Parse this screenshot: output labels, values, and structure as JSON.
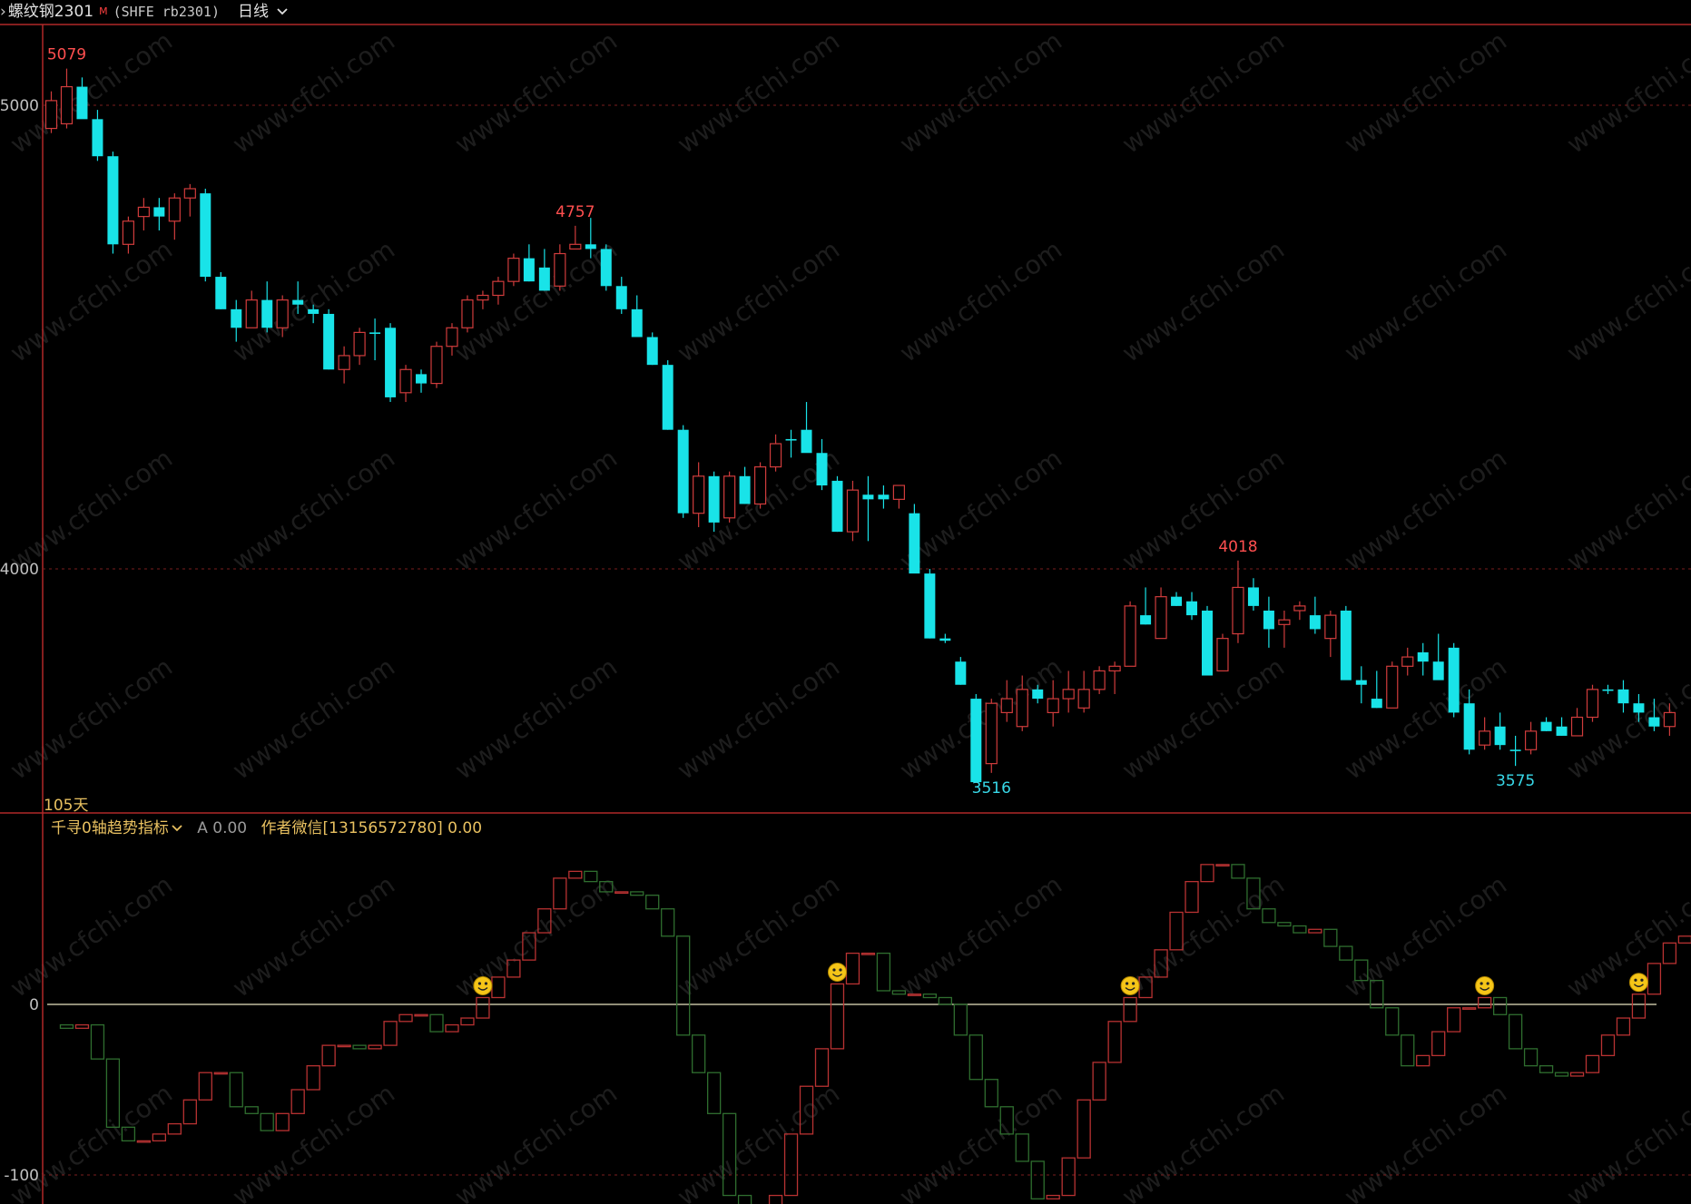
{
  "header": {
    "symbol": "螺纹钢2301",
    "marker": "M",
    "code": "(SHFE rb2301)",
    "period": "日线",
    "dropdown_icon": "chevron-down-icon"
  },
  "watermark_text": "www.cfchi.com",
  "days_label": "105天",
  "indicator": {
    "name": "千寻0轴趋势指标",
    "a_label": "A 0.00",
    "author_label": "作者微信[13156572780] 0.00",
    "signal_icon": "smiley-icon"
  },
  "colors": {
    "background": "#000000",
    "bear": "#19e3e8",
    "bull": "#d03c3c",
    "ind_up": "#b83232",
    "ind_down": "#2f6e2f",
    "zero_line": "#e8e4c0",
    "high_label": "#ff4f4f",
    "low_label": "#38d8e8"
  },
  "chart_data": [
    {
      "type": "candlestick",
      "yticks": [
        "5000",
        "4000"
      ],
      "ylim": [
        3470,
        5170
      ],
      "annotations": [
        {
          "index": 1,
          "text": "5079",
          "kind": "high"
        },
        {
          "index": 34,
          "text": "4757",
          "kind": "high"
        },
        {
          "index": 61,
          "text": "3516",
          "kind": "low"
        },
        {
          "index": 77,
          "text": "4018",
          "kind": "high"
        },
        {
          "index": 95,
          "text": "3575",
          "kind": "low"
        }
      ],
      "ohlc": [
        [
          4950,
          5030,
          4940,
          5010
        ],
        [
          4960,
          5079,
          4950,
          5040
        ],
        [
          5040,
          5060,
          4980,
          4970
        ],
        [
          4970,
          4990,
          4880,
          4890
        ],
        [
          4890,
          4900,
          4680,
          4700
        ],
        [
          4700,
          4760,
          4680,
          4750
        ],
        [
          4760,
          4800,
          4730,
          4780
        ],
        [
          4780,
          4800,
          4730,
          4760
        ],
        [
          4750,
          4810,
          4710,
          4800
        ],
        [
          4800,
          4830,
          4760,
          4820
        ],
        [
          4810,
          4820,
          4620,
          4630
        ],
        [
          4630,
          4640,
          4560,
          4560
        ],
        [
          4560,
          4580,
          4490,
          4520
        ],
        [
          4520,
          4600,
          4520,
          4580
        ],
        [
          4580,
          4620,
          4510,
          4520
        ],
        [
          4520,
          4590,
          4500,
          4580
        ],
        [
          4580,
          4620,
          4550,
          4570
        ],
        [
          4560,
          4570,
          4530,
          4550
        ],
        [
          4550,
          4560,
          4430,
          4430
        ],
        [
          4430,
          4480,
          4400,
          4460
        ],
        [
          4460,
          4520,
          4440,
          4510
        ],
        [
          4510,
          4540,
          4450,
          4510
        ],
        [
          4520,
          4530,
          4360,
          4370
        ],
        [
          4380,
          4440,
          4360,
          4430
        ],
        [
          4420,
          4430,
          4380,
          4400
        ],
        [
          4400,
          4490,
          4390,
          4480
        ],
        [
          4480,
          4530,
          4460,
          4520
        ],
        [
          4520,
          4590,
          4510,
          4580
        ],
        [
          4580,
          4600,
          4560,
          4590
        ],
        [
          4590,
          4630,
          4570,
          4620
        ],
        [
          4620,
          4680,
          4610,
          4670
        ],
        [
          4670,
          4700,
          4620,
          4620
        ],
        [
          4650,
          4690,
          4600,
          4600
        ],
        [
          4610,
          4700,
          4600,
          4680
        ],
        [
          4690,
          4740,
          4690,
          4700
        ],
        [
          4700,
          4757,
          4670,
          4690
        ],
        [
          4690,
          4700,
          4600,
          4610
        ],
        [
          4610,
          4630,
          4550,
          4560
        ],
        [
          4560,
          4590,
          4500,
          4500
        ],
        [
          4500,
          4510,
          4440,
          4440
        ],
        [
          4440,
          4450,
          4300,
          4300
        ],
        [
          4300,
          4310,
          4110,
          4120
        ],
        [
          4120,
          4230,
          4090,
          4200
        ],
        [
          4200,
          4210,
          4080,
          4100
        ],
        [
          4110,
          4210,
          4100,
          4200
        ],
        [
          4200,
          4220,
          4140,
          4140
        ],
        [
          4140,
          4230,
          4130,
          4220
        ],
        [
          4220,
          4290,
          4210,
          4270
        ],
        [
          4280,
          4300,
          4240,
          4280
        ],
        [
          4300,
          4360,
          4280,
          4250
        ],
        [
          4250,
          4280,
          4170,
          4180
        ],
        [
          4190,
          4200,
          4080,
          4080
        ],
        [
          4080,
          4190,
          4060,
          4170
        ],
        [
          4160,
          4200,
          4060,
          4150
        ],
        [
          4160,
          4180,
          4130,
          4150
        ],
        [
          4150,
          4180,
          4130,
          4180
        ],
        [
          4120,
          4140,
          4000,
          3990
        ],
        [
          3990,
          4000,
          3850,
          3850
        ],
        [
          3850,
          3860,
          3840,
          3845
        ],
        [
          3800,
          3810,
          3750,
          3750
        ],
        [
          3720,
          3730,
          3540,
          3540
        ],
        [
          3580,
          3720,
          3560,
          3710
        ],
        [
          3690,
          3760,
          3670,
          3720
        ],
        [
          3660,
          3770,
          3650,
          3740
        ],
        [
          3740,
          3750,
          3710,
          3720
        ],
        [
          3690,
          3760,
          3660,
          3720
        ],
        [
          3720,
          3780,
          3690,
          3740
        ],
        [
          3700,
          3780,
          3690,
          3740
        ],
        [
          3740,
          3790,
          3730,
          3780
        ],
        [
          3780,
          3800,
          3730,
          3790
        ],
        [
          3790,
          3930,
          3790,
          3920
        ],
        [
          3900,
          3960,
          3880,
          3880
        ],
        [
          3850,
          3960,
          3850,
          3940
        ],
        [
          3940,
          3950,
          3920,
          3920
        ],
        [
          3930,
          3950,
          3890,
          3900
        ],
        [
          3910,
          3920,
          3790,
          3770
        ],
        [
          3780,
          3860,
          3780,
          3850
        ],
        [
          3860,
          4018,
          3840,
          3960
        ],
        [
          3960,
          3980,
          3910,
          3920
        ],
        [
          3910,
          3940,
          3830,
          3870
        ],
        [
          3880,
          3910,
          3830,
          3890
        ],
        [
          3910,
          3930,
          3890,
          3920
        ],
        [
          3900,
          3940,
          3860,
          3870
        ],
        [
          3850,
          3910,
          3810,
          3900
        ],
        [
          3910,
          3920,
          3780,
          3760
        ],
        [
          3760,
          3790,
          3710,
          3750
        ],
        [
          3720,
          3780,
          3700,
          3700
        ],
        [
          3700,
          3800,
          3700,
          3790
        ],
        [
          3790,
          3830,
          3770,
          3810
        ],
        [
          3820,
          3840,
          3770,
          3800
        ],
        [
          3800,
          3860,
          3770,
          3760
        ],
        [
          3830,
          3840,
          3680,
          3690
        ],
        [
          3710,
          3740,
          3600,
          3610
        ],
        [
          3620,
          3680,
          3610,
          3650
        ],
        [
          3660,
          3690,
          3610,
          3620
        ],
        [
          3610,
          3640,
          3575,
          3610
        ],
        [
          3610,
          3670,
          3600,
          3650
        ],
        [
          3670,
          3680,
          3650,
          3650
        ],
        [
          3660,
          3680,
          3640,
          3640
        ],
        [
          3640,
          3700,
          3640,
          3680
        ],
        [
          3680,
          3750,
          3670,
          3740
        ],
        [
          3740,
          3750,
          3730,
          3740
        ],
        [
          3740,
          3760,
          3690,
          3710
        ],
        [
          3710,
          3730,
          3670,
          3690
        ],
        [
          3680,
          3720,
          3650,
          3660
        ],
        [
          3660,
          3710,
          3640,
          3690
        ]
      ]
    },
    {
      "type": "step",
      "title": "千寻0轴趋势指标",
      "yticks": [
        "0",
        "-100"
      ],
      "ylim": [
        -120,
        96
      ],
      "values": [
        -12,
        -14,
        -12,
        -32,
        -72,
        -80,
        -80,
        -76,
        -70,
        -56,
        -40,
        -40,
        -60,
        -64,
        -74,
        -64,
        -50,
        -36,
        -24,
        -24,
        -26,
        -24,
        -10,
        -6,
        -6,
        -16,
        -12,
        -8,
        4,
        16,
        26,
        42,
        56,
        74,
        78,
        72,
        66,
        66,
        64,
        56,
        40,
        -18,
        -40,
        -64,
        -112,
        -130,
        -136,
        -112,
        -76,
        -48,
        -26,
        12,
        30,
        30,
        8,
        6,
        6,
        4,
        0,
        -18,
        -44,
        -60,
        -76,
        -92,
        -114,
        -112,
        -90,
        -56,
        -34,
        -10,
        4,
        16,
        32,
        54,
        72,
        82,
        82,
        74,
        56,
        48,
        46,
        42,
        44,
        34,
        26,
        14,
        -2,
        -18,
        -36,
        -30,
        -16,
        -2,
        -2,
        4,
        -6,
        -26,
        -36,
        -40,
        -42,
        -40,
        -30,
        -18,
        -8,
        6,
        24,
        36,
        40,
        30,
        18,
        12
      ]
    }
  ]
}
